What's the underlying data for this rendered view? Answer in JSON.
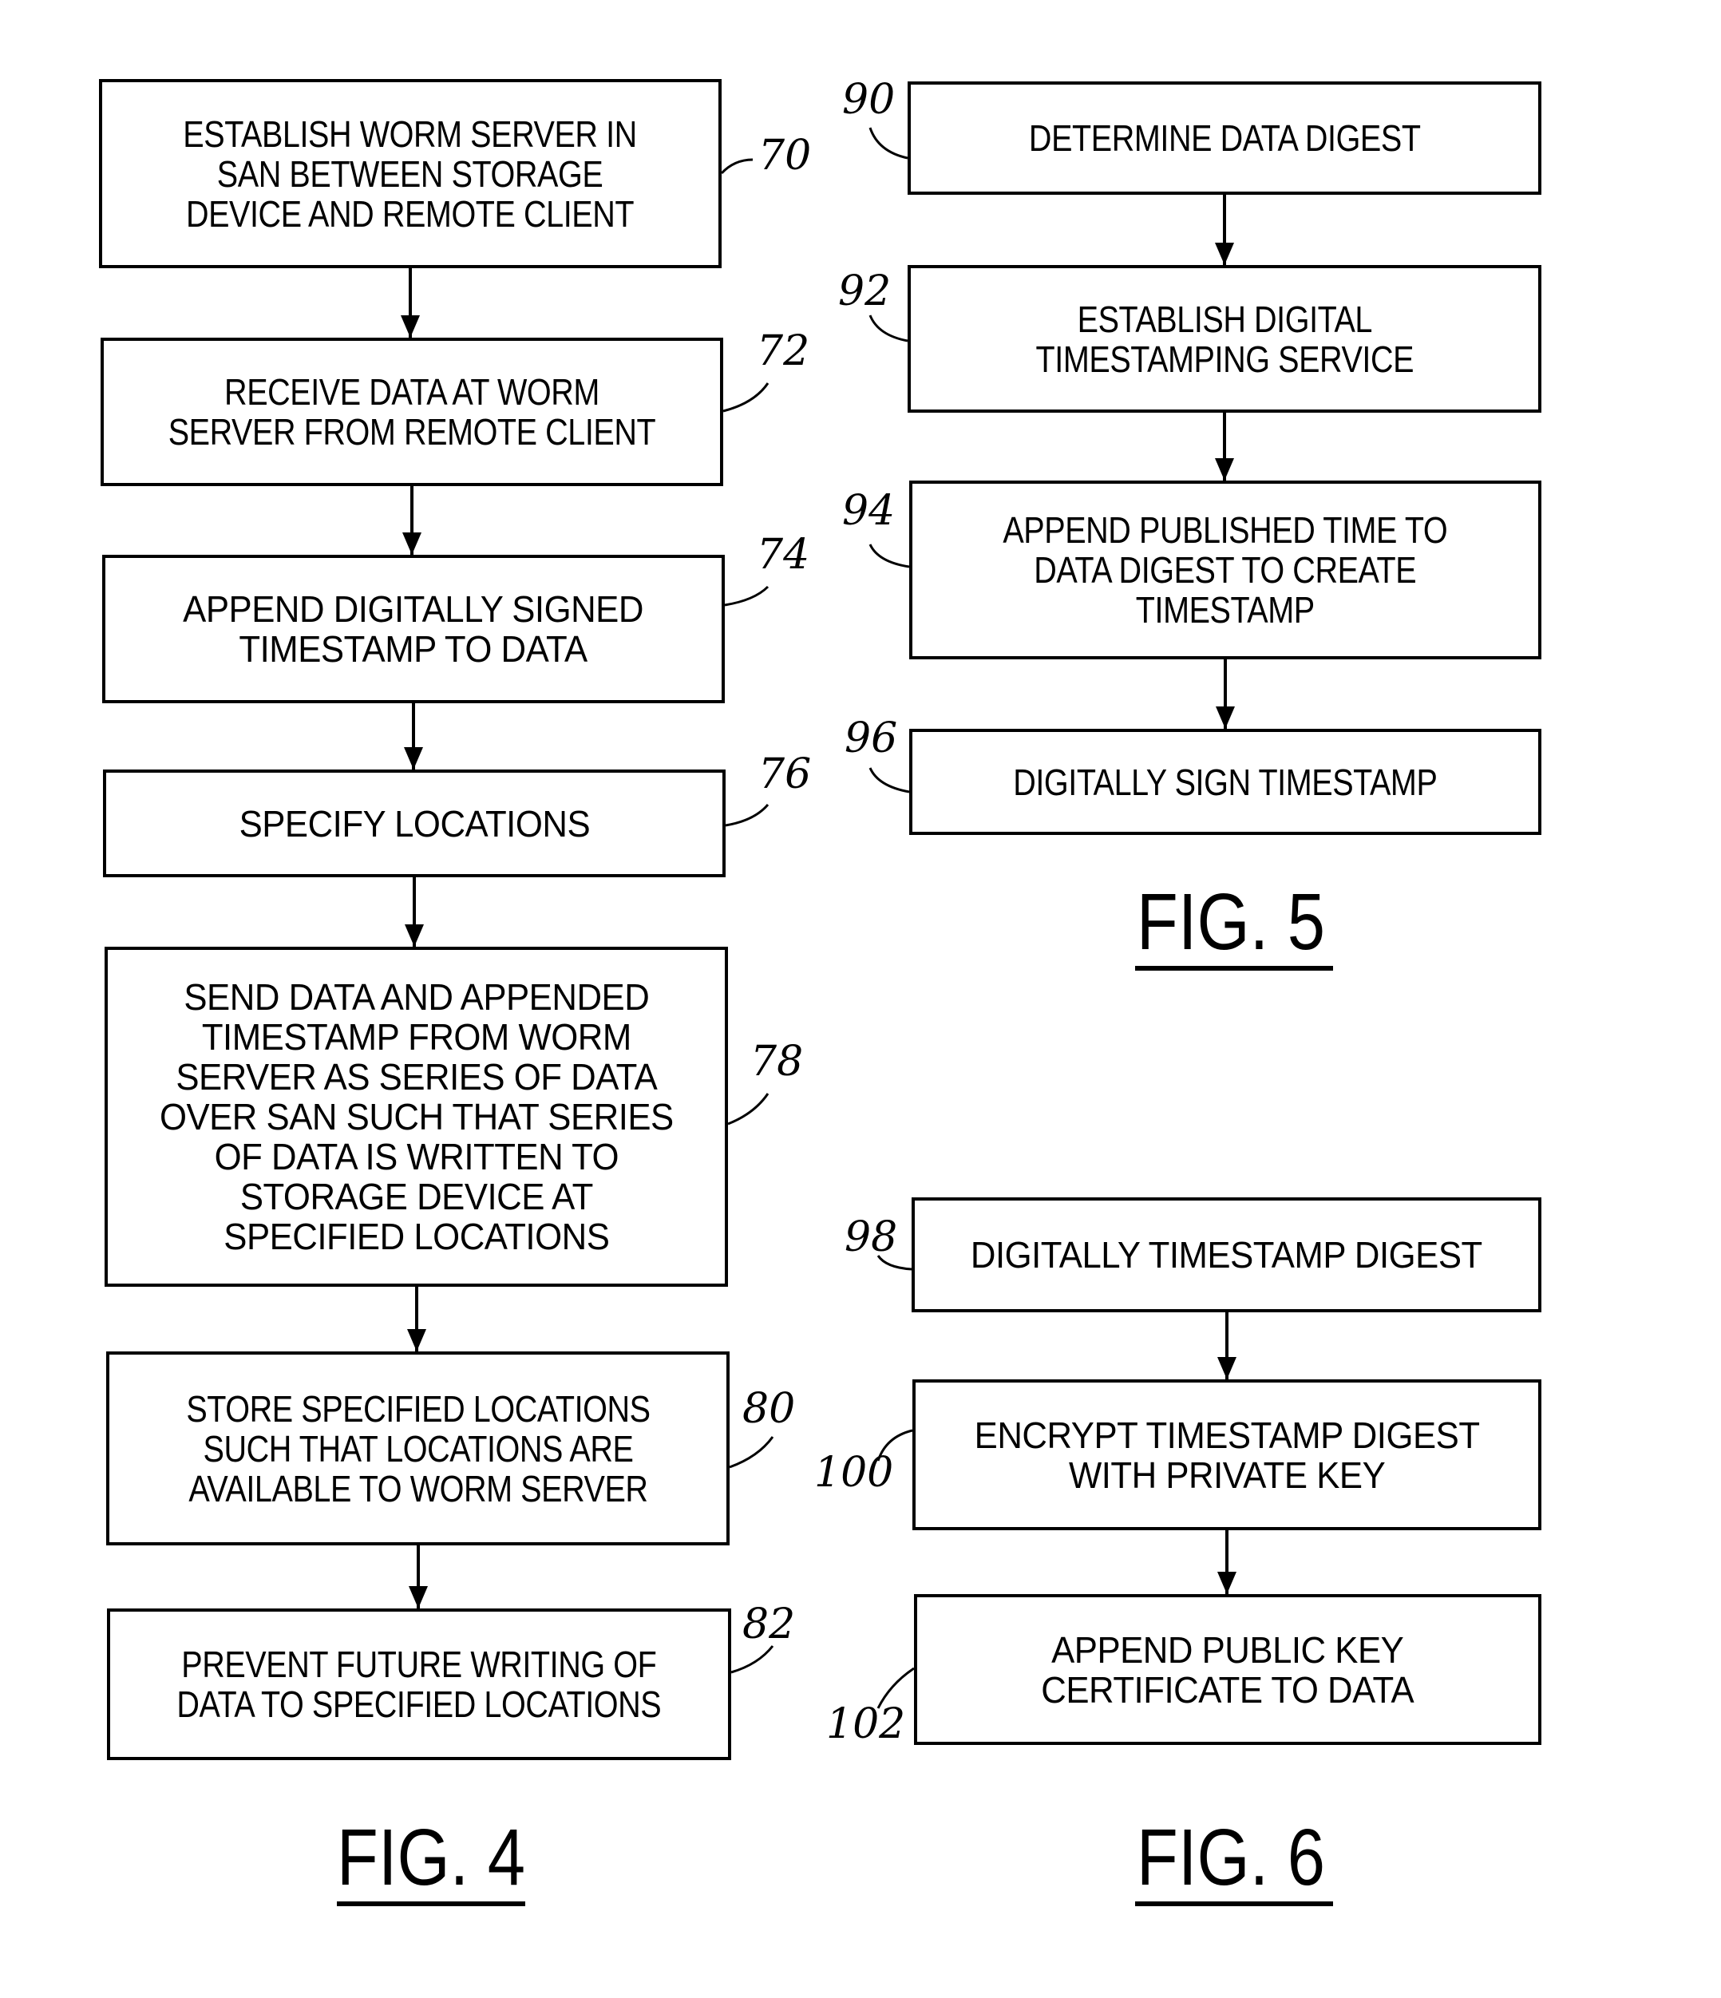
{
  "figures": [
    {
      "label": "FIG. 4",
      "steps": [
        {
          "ref": "70",
          "text": "ESTABLISH WORM SERVER IN\nSAN BETWEEN STORAGE\nDEVICE AND REMOTE CLIENT"
        },
        {
          "ref": "72",
          "text": "RECEIVE DATA AT WORM\nSERVER FROM REMOTE CLIENT"
        },
        {
          "ref": "74",
          "text": "APPEND DIGITALLY SIGNED\nTIMESTAMP TO DATA"
        },
        {
          "ref": "76",
          "text": "SPECIFY LOCATIONS"
        },
        {
          "ref": "78",
          "text": "SEND DATA AND APPENDED\nTIMESTAMP FROM WORM\nSERVER AS SERIES OF DATA\nOVER SAN SUCH THAT SERIES\nOF DATA IS WRITTEN TO\nSTORAGE DEVICE AT\nSPECIFIED LOCATIONS"
        },
        {
          "ref": "80",
          "text": "STORE SPECIFIED LOCATIONS\nSUCH THAT LOCATIONS ARE\nAVAILABLE TO WORM SERVER"
        },
        {
          "ref": "82",
          "text": "PREVENT FUTURE WRITING OF\nDATA TO SPECIFIED LOCATIONS"
        }
      ]
    },
    {
      "label": "FIG. 5",
      "steps": [
        {
          "ref": "90",
          "text": "DETERMINE DATA DIGEST"
        },
        {
          "ref": "92",
          "text": "ESTABLISH DIGITAL\nTIMESTAMPING SERVICE"
        },
        {
          "ref": "94",
          "text": "APPEND PUBLISHED TIME TO\nDATA DIGEST TO CREATE\nTIMESTAMP"
        },
        {
          "ref": "96",
          "text": "DIGITALLY SIGN TIMESTAMP"
        }
      ]
    },
    {
      "label": "FIG. 6",
      "steps": [
        {
          "ref": "98",
          "text": "DIGITALLY TIMESTAMP DIGEST"
        },
        {
          "ref": "100",
          "text": "ENCRYPT TIMESTAMP DIGEST\nWITH PRIVATE KEY"
        },
        {
          "ref": "102",
          "text": "APPEND PUBLIC KEY\nCERTIFICATE TO DATA"
        }
      ]
    }
  ]
}
